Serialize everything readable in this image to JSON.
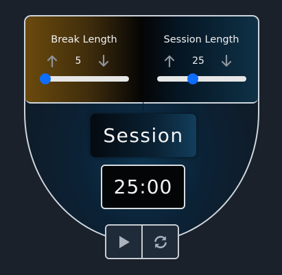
{
  "break": {
    "label": "Break Length",
    "value": "5",
    "slider_fraction": 0.06
  },
  "session": {
    "label": "Session Length",
    "value": "25",
    "slider_fraction": 0.4
  },
  "display": {
    "mode_label": "Session",
    "time": "25:00"
  },
  "icons": {
    "increment": "arrow-up-icon",
    "decrement": "arrow-down-icon",
    "play": "play-icon",
    "reset": "refresh-icon"
  },
  "colors": {
    "slider_thumb": "#0d6efd",
    "break_accent": "#6b4a0d",
    "session_accent": "#0f3147",
    "background": "#1a212b"
  }
}
